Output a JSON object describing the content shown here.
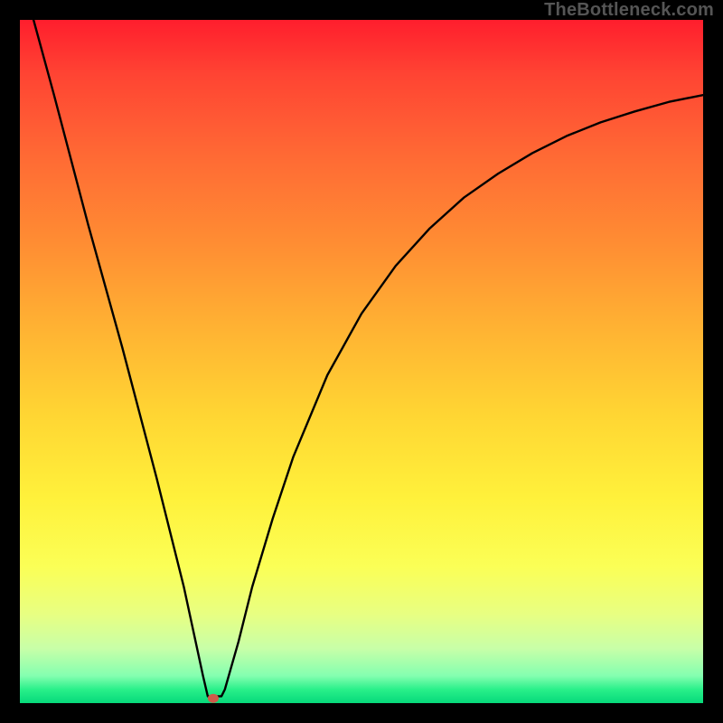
{
  "watermark": "TheBottleneck.com",
  "chart_data": {
    "type": "line",
    "title": "",
    "xlabel": "",
    "ylabel": "",
    "xlim": [
      0,
      100
    ],
    "ylim": [
      0,
      100
    ],
    "grid": false,
    "legend": false,
    "series": [
      {
        "name": "bottleneck-curve",
        "color": "#000000",
        "x": [
          2,
          5,
          10,
          15,
          20,
          24,
          26.8,
          27.5,
          28.2,
          29.5,
          30,
          32,
          34,
          37,
          40,
          45,
          50,
          55,
          60,
          65,
          70,
          75,
          80,
          85,
          90,
          95,
          100
        ],
        "y": [
          100,
          89,
          70,
          52,
          33,
          17,
          4,
          1,
          1,
          1,
          2,
          9,
          17,
          27,
          36,
          48,
          57,
          64,
          69.5,
          74,
          77.5,
          80.5,
          83,
          85,
          86.6,
          88,
          89
        ]
      }
    ],
    "markers": [
      {
        "name": "optimum-point",
        "x": 28.3,
        "y": 0.7,
        "color": "#d05a4a",
        "rx": 6,
        "ry": 5
      }
    ],
    "gradient_stops": [
      {
        "pct": 0,
        "color": "#ff1e2d"
      },
      {
        "pct": 20,
        "color": "#ff6a34"
      },
      {
        "pct": 45,
        "color": "#ffb233"
      },
      {
        "pct": 70,
        "color": "#fff13b"
      },
      {
        "pct": 92,
        "color": "#c8ffa8"
      },
      {
        "pct": 100,
        "color": "#06d97a"
      }
    ]
  }
}
